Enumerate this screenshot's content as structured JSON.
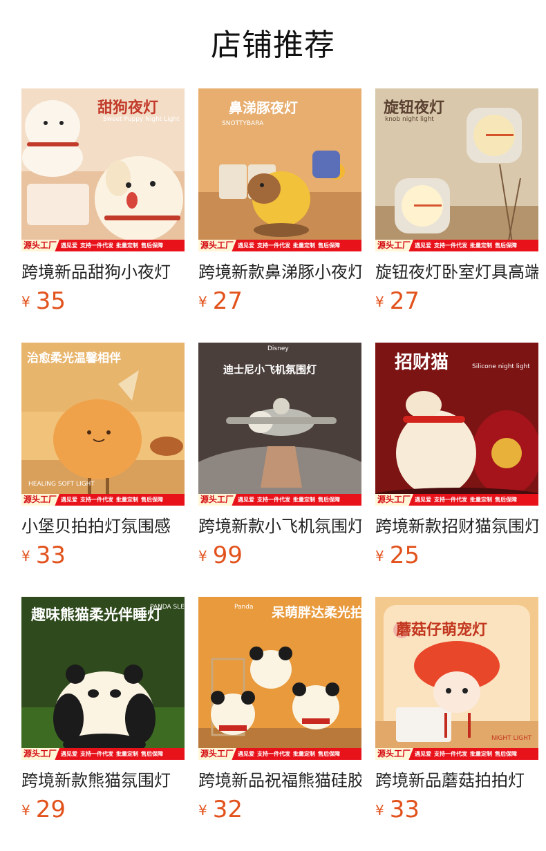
{
  "section": {
    "title": "店铺推荐"
  },
  "currency": "¥",
  "promo": {
    "tag": "源头工厂",
    "items": [
      "遇见爱",
      "支持一件代发",
      "批量定制",
      "售后保障"
    ]
  },
  "products": [
    {
      "title": "跨境新品甜狗小夜灯",
      "price": "35",
      "headline": "甜狗夜灯",
      "subline": "Sweet Puppy Night Light",
      "colors": {
        "bg": "#f3ddc6",
        "accent": "#c23a2a",
        "subject": "#fbf2e2"
      },
      "icon": "puppy-lamp-icon"
    },
    {
      "title": "跨境新款鼻涕豚小夜灯",
      "price": "27",
      "headline": "鼻涕豚夜灯",
      "subline": "SNOTTYBARA",
      "colors": {
        "bg": "#e7ae6f",
        "accent": "#ffffff",
        "subject": "#f3c23b"
      },
      "icon": "capybara-lamp-icon"
    },
    {
      "title": "旋钮夜灯卧室灯具高端",
      "price": "27",
      "headline": "旋钮夜灯",
      "subline": "knob night light",
      "colors": {
        "bg": "#d9c8ac",
        "accent": "#5a4030",
        "subject": "#f7e7b8"
      },
      "icon": "knob-lamp-icon"
    },
    {
      "title": "小堡贝拍拍灯氛围感",
      "price": "33",
      "headline": "治愈柔光温馨相伴",
      "subline": "HEALING SOFT LIGHT",
      "colors": {
        "bg": "#f0c27a",
        "accent": "#ffffff",
        "subject": "#f0a24a"
      },
      "icon": "burger-lamp-icon"
    },
    {
      "title": "跨境新款小飞机氛围灯",
      "price": "99",
      "headline": "迪士尼小飞机氛围灯",
      "subline": "Disney",
      "colors": {
        "bg": "#4b3f3b",
        "accent": "#ffffff",
        "subject": "#bdbcb4"
      },
      "icon": "airplane-lamp-icon"
    },
    {
      "title": "跨境新款招财猫氛围灯",
      "price": "25",
      "headline": "招财猫",
      "subline": "Silicone night light",
      "colors": {
        "bg": "#7d1414",
        "accent": "#ffffff",
        "subject": "#f8ecd8"
      },
      "icon": "lucky-cat-lamp-icon"
    },
    {
      "title": "跨境新款熊猫氛围灯",
      "price": "29",
      "headline": "趣味熊猫柔光伴睡灯",
      "subline": "PANDA SLEEP LAMP",
      "colors": {
        "bg": "#2f4a1c",
        "accent": "#ffffff",
        "subject": "#fbf4e3"
      },
      "icon": "panda-lamp-icon"
    },
    {
      "title": "跨境新品祝福熊猫硅胶",
      "price": "32",
      "headline": "呆萌胖达柔光拍拍灯",
      "subline": "Panda",
      "colors": {
        "bg": "#e89a3c",
        "accent": "#ffffff",
        "subject": "#fbf4e3"
      },
      "icon": "panda-group-icon"
    },
    {
      "title": "跨境新品蘑菇拍拍灯",
      "price": "33",
      "headline": "蘑菇仔萌宠灯",
      "subline": "NIGHT LIGHT",
      "colors": {
        "bg": "#f4c98e",
        "accent": "#c2361e",
        "subject": "#e9472a"
      },
      "icon": "mushroom-lamp-icon"
    }
  ]
}
